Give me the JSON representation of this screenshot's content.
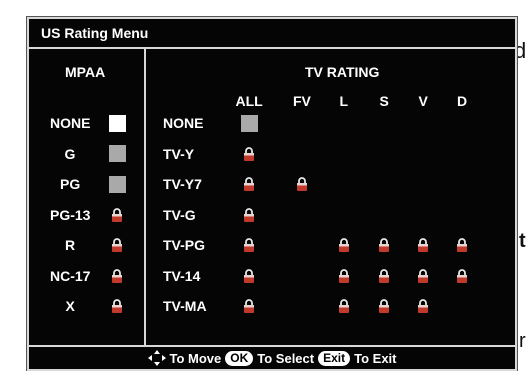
{
  "background_text": {
    "left_d": "d",
    "left_t": "t",
    "left_r": "r"
  },
  "menu": {
    "title": "US Rating Menu",
    "mpaa_header": "MPAA",
    "tv_header": "TV RATING",
    "tv_columns": [
      "ALL",
      "FV",
      "L",
      "S",
      "V",
      "D"
    ],
    "mpaa_rows": [
      {
        "label": "NONE",
        "state": "white-box"
      },
      {
        "label": "G",
        "state": "gray-box"
      },
      {
        "label": "PG",
        "state": "gray-box"
      },
      {
        "label": "PG-13",
        "state": "lock"
      },
      {
        "label": "R",
        "state": "lock"
      },
      {
        "label": "NC-17",
        "state": "lock"
      },
      {
        "label": "X",
        "state": "lock"
      }
    ],
    "tv_rows": [
      {
        "label": "NONE",
        "cells": [
          "gray-box",
          "",
          "",
          "",
          "",
          ""
        ]
      },
      {
        "label": "TV-Y",
        "cells": [
          "lock",
          "",
          "",
          "",
          "",
          ""
        ]
      },
      {
        "label": "TV-Y7",
        "cells": [
          "lock",
          "lock",
          "",
          "",
          "",
          ""
        ]
      },
      {
        "label": "TV-G",
        "cells": [
          "lock",
          "",
          "",
          "",
          "",
          ""
        ]
      },
      {
        "label": "TV-PG",
        "cells": [
          "lock",
          "",
          "lock",
          "lock",
          "lock",
          "lock"
        ]
      },
      {
        "label": "TV-14",
        "cells": [
          "lock",
          "",
          "lock",
          "lock",
          "lock",
          "lock"
        ]
      },
      {
        "label": "TV-MA",
        "cells": [
          "lock",
          "",
          "lock",
          "lock",
          "lock",
          ""
        ]
      }
    ],
    "footer": {
      "move_icon": "four-way-arrow-icon",
      "move_text": "To Move",
      "ok_key": "OK",
      "select_text": "To Select",
      "exit_key": "Exit",
      "exit_text": "To Exit"
    },
    "colors": {
      "panel": "#050505",
      "border": "#d8d8d8",
      "box_gray": "#a9a9a9",
      "lock_red": "#c0392b"
    }
  }
}
